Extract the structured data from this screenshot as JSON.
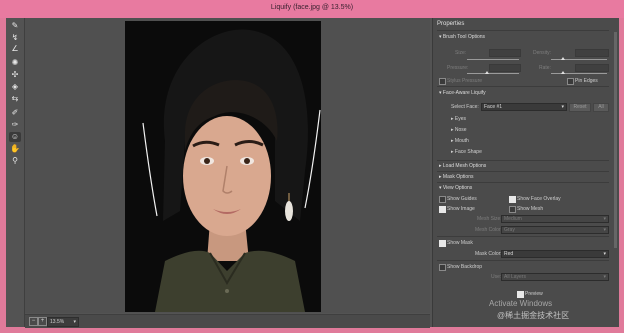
{
  "window": {
    "title": "Liquify (face.jpg @ 13.5%)"
  },
  "toolbar": {
    "tools": [
      {
        "name": "forward-warp-tool",
        "glyph": "✎"
      },
      {
        "name": "reconstruct-tool",
        "glyph": "↯"
      },
      {
        "name": "smooth-tool",
        "glyph": "∠"
      },
      {
        "name": "twirl-tool",
        "glyph": "✺"
      },
      {
        "name": "pucker-tool",
        "glyph": "✣"
      },
      {
        "name": "bloat-tool",
        "glyph": "◈"
      },
      {
        "name": "push-left-tool",
        "glyph": "⇆"
      },
      {
        "name": "freeze-mask-tool",
        "glyph": "✐"
      },
      {
        "name": "thaw-mask-tool",
        "glyph": "✑"
      },
      {
        "name": "face-tool",
        "glyph": "☺"
      },
      {
        "name": "hand-tool",
        "glyph": "✋"
      },
      {
        "name": "zoom-tool",
        "glyph": "⚲"
      }
    ],
    "active": 9
  },
  "status": {
    "zoom": "13.5%",
    "minus": "−",
    "plus": "+"
  },
  "panel": {
    "title": "Properties",
    "brush": {
      "header": "Brush Tool Options",
      "size": "Size:",
      "density": "Density:",
      "pressure": "Pressure:",
      "rate": "Rate:",
      "stylus": "Stylus Pressure",
      "pin_edges": "Pin Edges"
    },
    "face": {
      "header": "Face-Aware Liquify",
      "select_face": "Select Face:",
      "face_value": "Face #1",
      "reset": "Reset",
      "all": "All",
      "items": [
        "Eyes",
        "Nose",
        "Mouth",
        "Face Shape"
      ]
    },
    "load_mesh": "Load Mesh Options",
    "mask_options": "Mask Options",
    "view": {
      "header": "View Options",
      "show_guides": "Show Guides",
      "show_face_overlay": "Show Face Overlay",
      "show_image": "Show Image",
      "show_mesh": "Show Mesh",
      "mesh_size": "Mesh Size:",
      "mesh_size_value": "Medium",
      "mesh_color": "Mesh Color:",
      "mesh_color_value": "Gray",
      "show_mask": "Show Mask",
      "mask_color": "Mask Color:",
      "mask_color_value": "Red",
      "show_backdrop": "Show Backdrop",
      "use": "Use:",
      "use_value": "All Layers"
    },
    "preview": "Preview"
  },
  "watermark": {
    "line1": "Activate Windows",
    "line2": "@稀土掘金技术社区"
  },
  "colors": {
    "title_bar": "#e87aa0",
    "panel_bg": "#4b4b4b",
    "canvas_bg": "#505050"
  }
}
